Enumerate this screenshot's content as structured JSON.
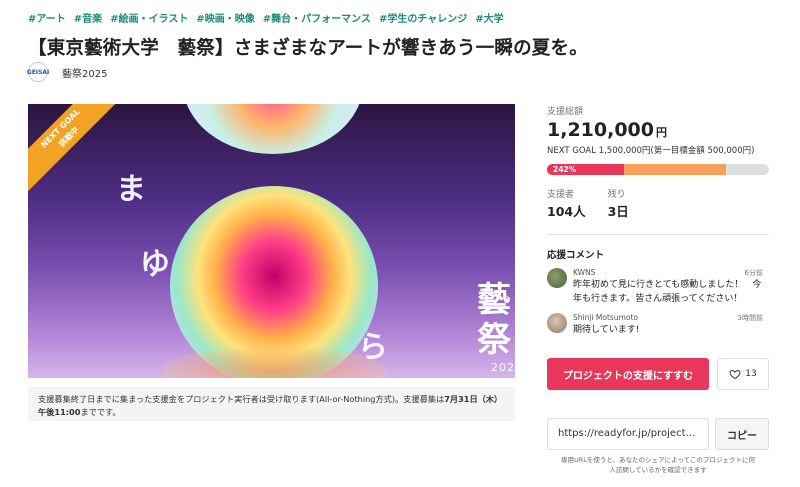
{
  "tags": [
    "#アート",
    "#音楽",
    "#絵画・イラスト",
    "#映画・映像",
    "#舞台・パフォーマンス",
    "#学生のチャレンジ",
    "#大学"
  ],
  "project": {
    "title": "【東京藝術大学　藝祭】さまざまなアートが響きあう一瞬の夏を。",
    "org_logo_text": "GEISAI",
    "org_name": "藝祭2025"
  },
  "hero": {
    "ribbon_line1": "NEXT GOAL",
    "ribbon_line2": "挑戦中",
    "chars": [
      "ま",
      "ゆ",
      "ら"
    ],
    "fest_chars": [
      "藝",
      "祭"
    ],
    "year": "202"
  },
  "notice": {
    "text_prefix": "支援募集終了日までに集まった支援金をプロジェクト実行者は受け取ります(All-or-Nothing方式)。支援募集は",
    "text_bold": "7月31日（木）午後11:00",
    "text_suffix": "までです。"
  },
  "funding": {
    "total_label": "支援総額",
    "amount": "1,210,000",
    "currency": "円",
    "goal_text": "NEXT GOAL 1,500,000円(第一目標金額 500,000円)",
    "progress_percent_label": "242%",
    "progress_to_next_goal": 0.807,
    "progress_percent": 242,
    "colors": {
      "primary": "#e8375a",
      "secondary": "#f7a05a"
    }
  },
  "stats": {
    "supporters_label": "支援者",
    "supporters_value": "104人",
    "remaining_label": "残り",
    "remaining_value": "3日"
  },
  "comments": {
    "title": "応援コメント",
    "items": [
      {
        "name": "KWNS",
        "time": "6分前",
        "text": "昨年初めて見に行きとても感動しました！　今年も行きます。皆さん頑張ってください！"
      },
      {
        "name": "Shinji Motsumoto",
        "time": "3時間前",
        "text": "期待しています!"
      }
    ]
  },
  "actions": {
    "support_label": "プロジェクトの支援にすすむ",
    "favorite_count": "13",
    "url": "https://readyfor.jp/projects/...",
    "copy_label": "コピー",
    "url_note": "専用URLを使うと、あなたのシェアによってこのプロジェクトに何人訪問しているかを確認できます"
  }
}
